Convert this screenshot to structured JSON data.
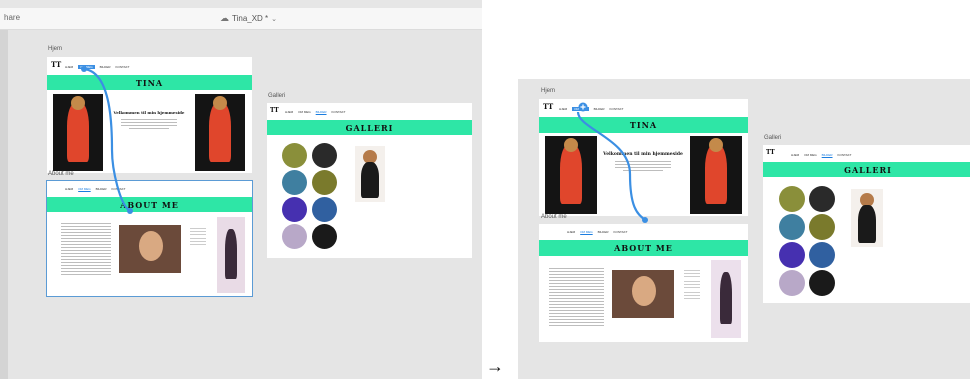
{
  "titlebar": {
    "share_label": "hare",
    "doc_title": "Tina_XD *"
  },
  "artboards": {
    "home": {
      "label": "Hjem",
      "banner": "TINA",
      "welcome": "Velkommen til min hjemmeside"
    },
    "about": {
      "label": "About me",
      "banner": "ABOUT ME"
    },
    "gallery": {
      "label": "Galleri",
      "banner": "GALLERI"
    }
  },
  "nav": {
    "items": [
      "HJEM",
      "OM MEG",
      "BILDER",
      "KONTAKT"
    ]
  },
  "logo": "TT",
  "icons": {
    "cloud": "cloud-icon",
    "chevron": "chevron-down-icon",
    "plus": "plus-icon",
    "arrow": "right-arrow-icon"
  },
  "colors": {
    "banner": "#2ee6a6",
    "link": "#3b8fe3",
    "canvas": "#e5e5e5"
  },
  "arrow_symbol": "→"
}
